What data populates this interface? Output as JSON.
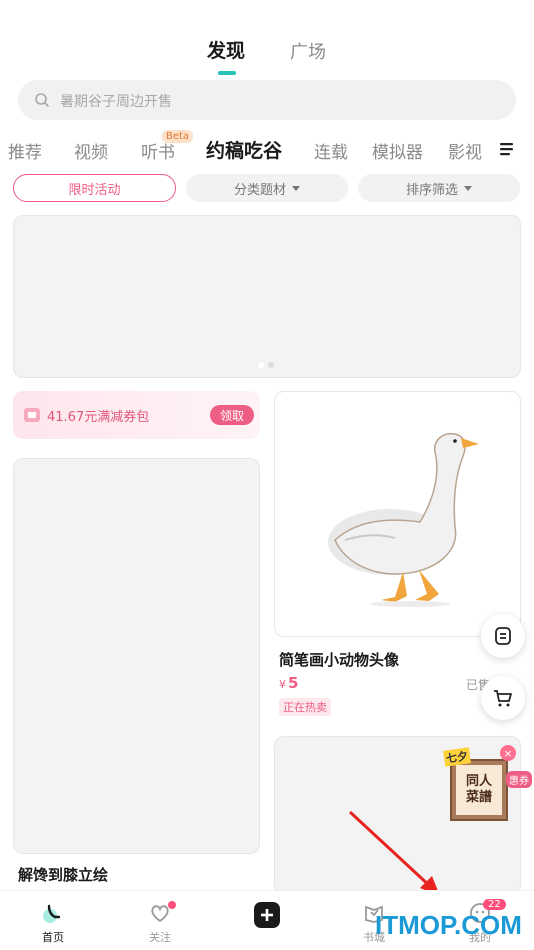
{
  "top_tabs": {
    "discover": "发现",
    "square": "广场"
  },
  "search": {
    "placeholder": "暑期谷子周边开售"
  },
  "categories": [
    {
      "label": "推荐"
    },
    {
      "label": "视频"
    },
    {
      "label": "听书"
    },
    {
      "label": "约稿吃谷"
    },
    {
      "label": "连载"
    },
    {
      "label": "模拟器"
    },
    {
      "label": "影视"
    }
  ],
  "beta_label": "Beta",
  "filters": {
    "limited": "限时活动",
    "category": "分类题材",
    "sort": "排序筛选"
  },
  "coupon": {
    "text": "41.67元满减券包",
    "button": "领取"
  },
  "cards": {
    "left_title": "解馋到膝立绘",
    "right_title": "简笔画小动物头像",
    "price_symbol": "¥",
    "price": "5",
    "sold": "已售",
    "hot_tag": "正在热卖"
  },
  "promo": {
    "tag": "七夕",
    "line1": "同人",
    "line2": "菜譜",
    "badge": "惠券"
  },
  "bottom_nav": {
    "home": "首页",
    "follow": "关注",
    "bookshelf": "书城",
    "mine": "我的",
    "mine_badge": "22"
  },
  "watermark": "ITMOP.COM",
  "colors": {
    "accent": "#26c2b6",
    "pink": "#ee5d83",
    "watermark": "#1b9ad6"
  }
}
